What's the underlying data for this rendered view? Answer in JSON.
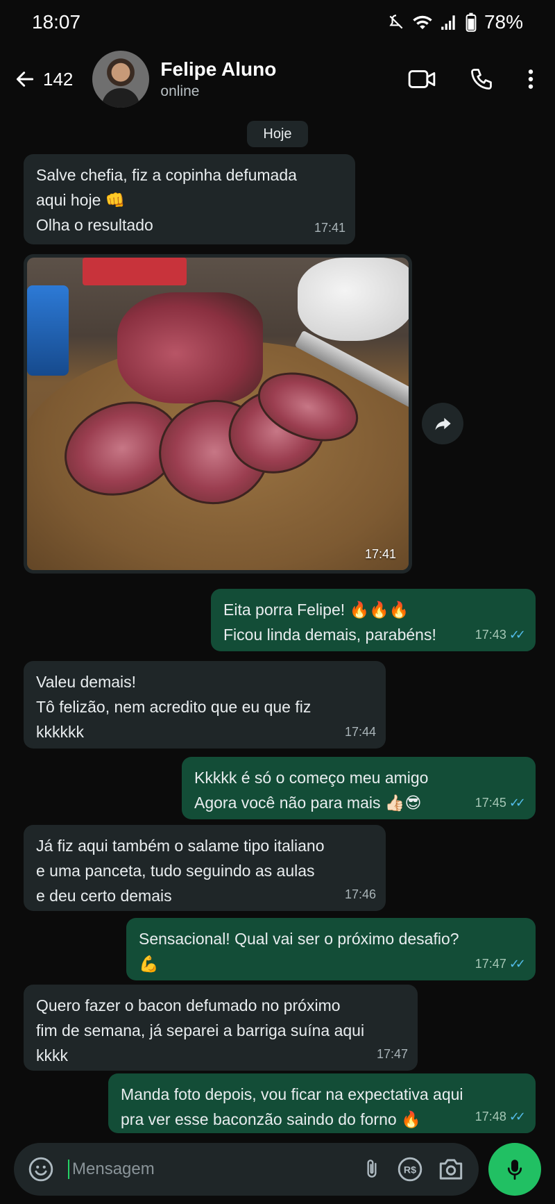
{
  "status_bar": {
    "time": "18:07",
    "battery": "78%",
    "icons": [
      "mute-icon",
      "wifi-icon",
      "signal-icon",
      "battery-icon"
    ]
  },
  "header": {
    "back_count": "142",
    "contact_name": "Felipe Aluno",
    "contact_status": "online",
    "actions": [
      "video-call-icon",
      "voice-call-icon",
      "more-options-icon"
    ]
  },
  "chat": {
    "date_chip": "Hoje",
    "messages": [
      {
        "dir": "in",
        "text": "Salve chefia, fiz a copinha defumada\naqui hoje 👊\nOlha o resultado",
        "time": "17:41"
      },
      {
        "dir": "in",
        "type": "image",
        "time": "17:41"
      },
      {
        "dir": "out",
        "text": "Eita porra Felipe! 🔥🔥🔥\nFicou linda demais, parabéns!",
        "time": "17:43"
      },
      {
        "dir": "in",
        "text": "Valeu demais!\nTô felizão, nem acredito que eu que fiz\nkkkkkk",
        "time": "17:44"
      },
      {
        "dir": "out",
        "text": "Kkkkk é só o começo meu amigo\nAgora você não para mais 👍🏻😎",
        "time": "17:45"
      },
      {
        "dir": "in",
        "text": "Já fiz aqui também o salame tipo italiano\ne uma panceta, tudo seguindo as aulas\ne deu certo demais",
        "time": "17:46"
      },
      {
        "dir": "out",
        "text": "Sensacional! Qual vai ser o próximo desafio?\n💪",
        "time": "17:47"
      },
      {
        "dir": "in",
        "text": "Quero fazer o bacon defumado no próximo\nfim de semana, já separei a barriga suína aqui\nkkkk",
        "time": "17:47"
      },
      {
        "dir": "out",
        "text": "Manda foto depois, vou ficar na expectativa aqui\npra ver esse baconzão saindo do forno 🔥",
        "time": "17:48"
      }
    ]
  },
  "composer": {
    "placeholder": "Mensagem",
    "icons": [
      "emoji-icon",
      "attach-icon",
      "payment-icon",
      "camera-icon",
      "mic-icon"
    ]
  },
  "colors": {
    "incoming_bubble": "#1f2628",
    "outgoing_bubble": "#134d37",
    "read_ticks": "#53bdeb",
    "mic_button": "#21c063"
  }
}
